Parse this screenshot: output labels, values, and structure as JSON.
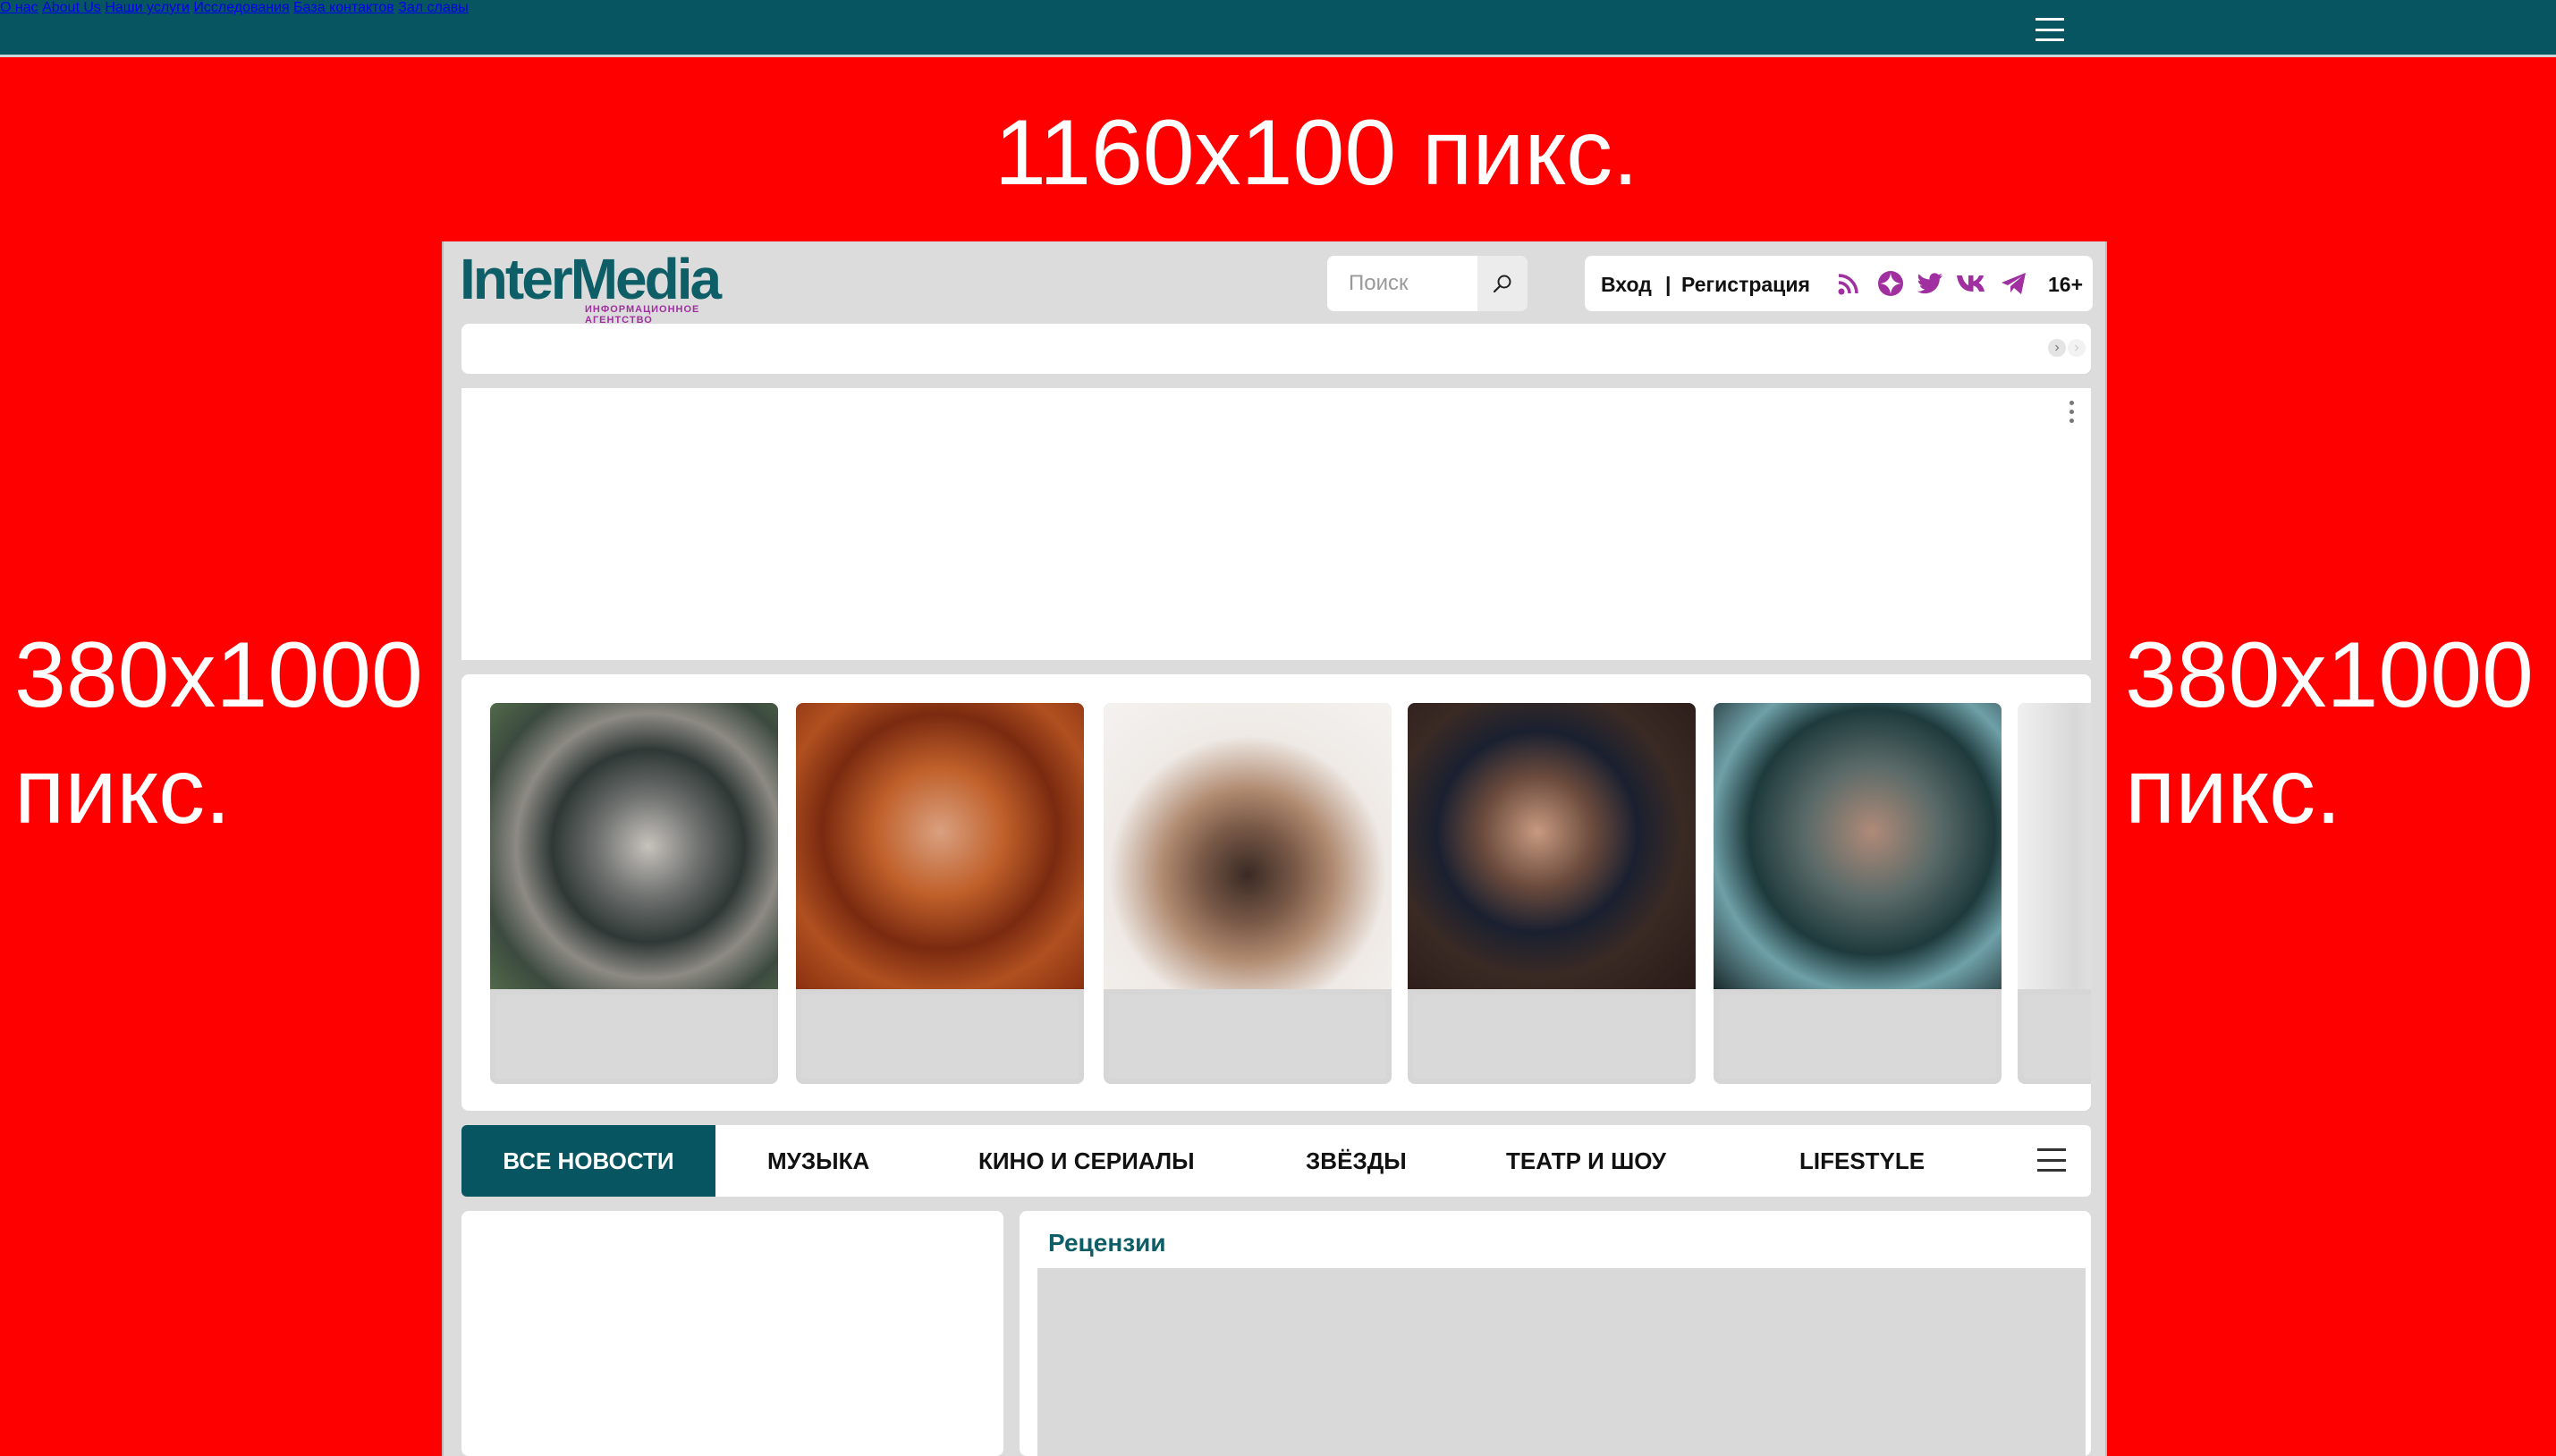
{
  "topnav": {
    "items": [
      "О нас",
      "About Us",
      "Наши услуги",
      "Исследования",
      "База контактов",
      "Зал славы"
    ]
  },
  "ads": {
    "top": "1160x100 пикс.",
    "left_line1": "380x1000",
    "left_line2": "пикс.",
    "right_line1": "380x1000",
    "right_line2": "пикс."
  },
  "header": {
    "logo_main": "InterMedia",
    "logo_sub": "ИНФОРМАЦИОННОЕ АГЕНТСТВО",
    "search_placeholder": "Поиск",
    "login": "Вход",
    "separator": "|",
    "register": "Регистрация",
    "age": "16+",
    "social_icons": [
      "rss-icon",
      "zen-icon",
      "twitter-icon",
      "vk-icon",
      "telegram-icon"
    ]
  },
  "tabs": {
    "items": [
      "ВСЕ НОВОСТИ",
      "МУЗЫКА",
      "КИНО И СЕРИАЛЫ",
      "ЗВЁЗДЫ",
      "ТЕАТР И ШОУ",
      "LIFESTYLE"
    ]
  },
  "reviews": {
    "title": "Рецензии"
  },
  "colors": {
    "brand": "#065560",
    "accent": "#a030a0",
    "ad_background": "#ff0000"
  }
}
